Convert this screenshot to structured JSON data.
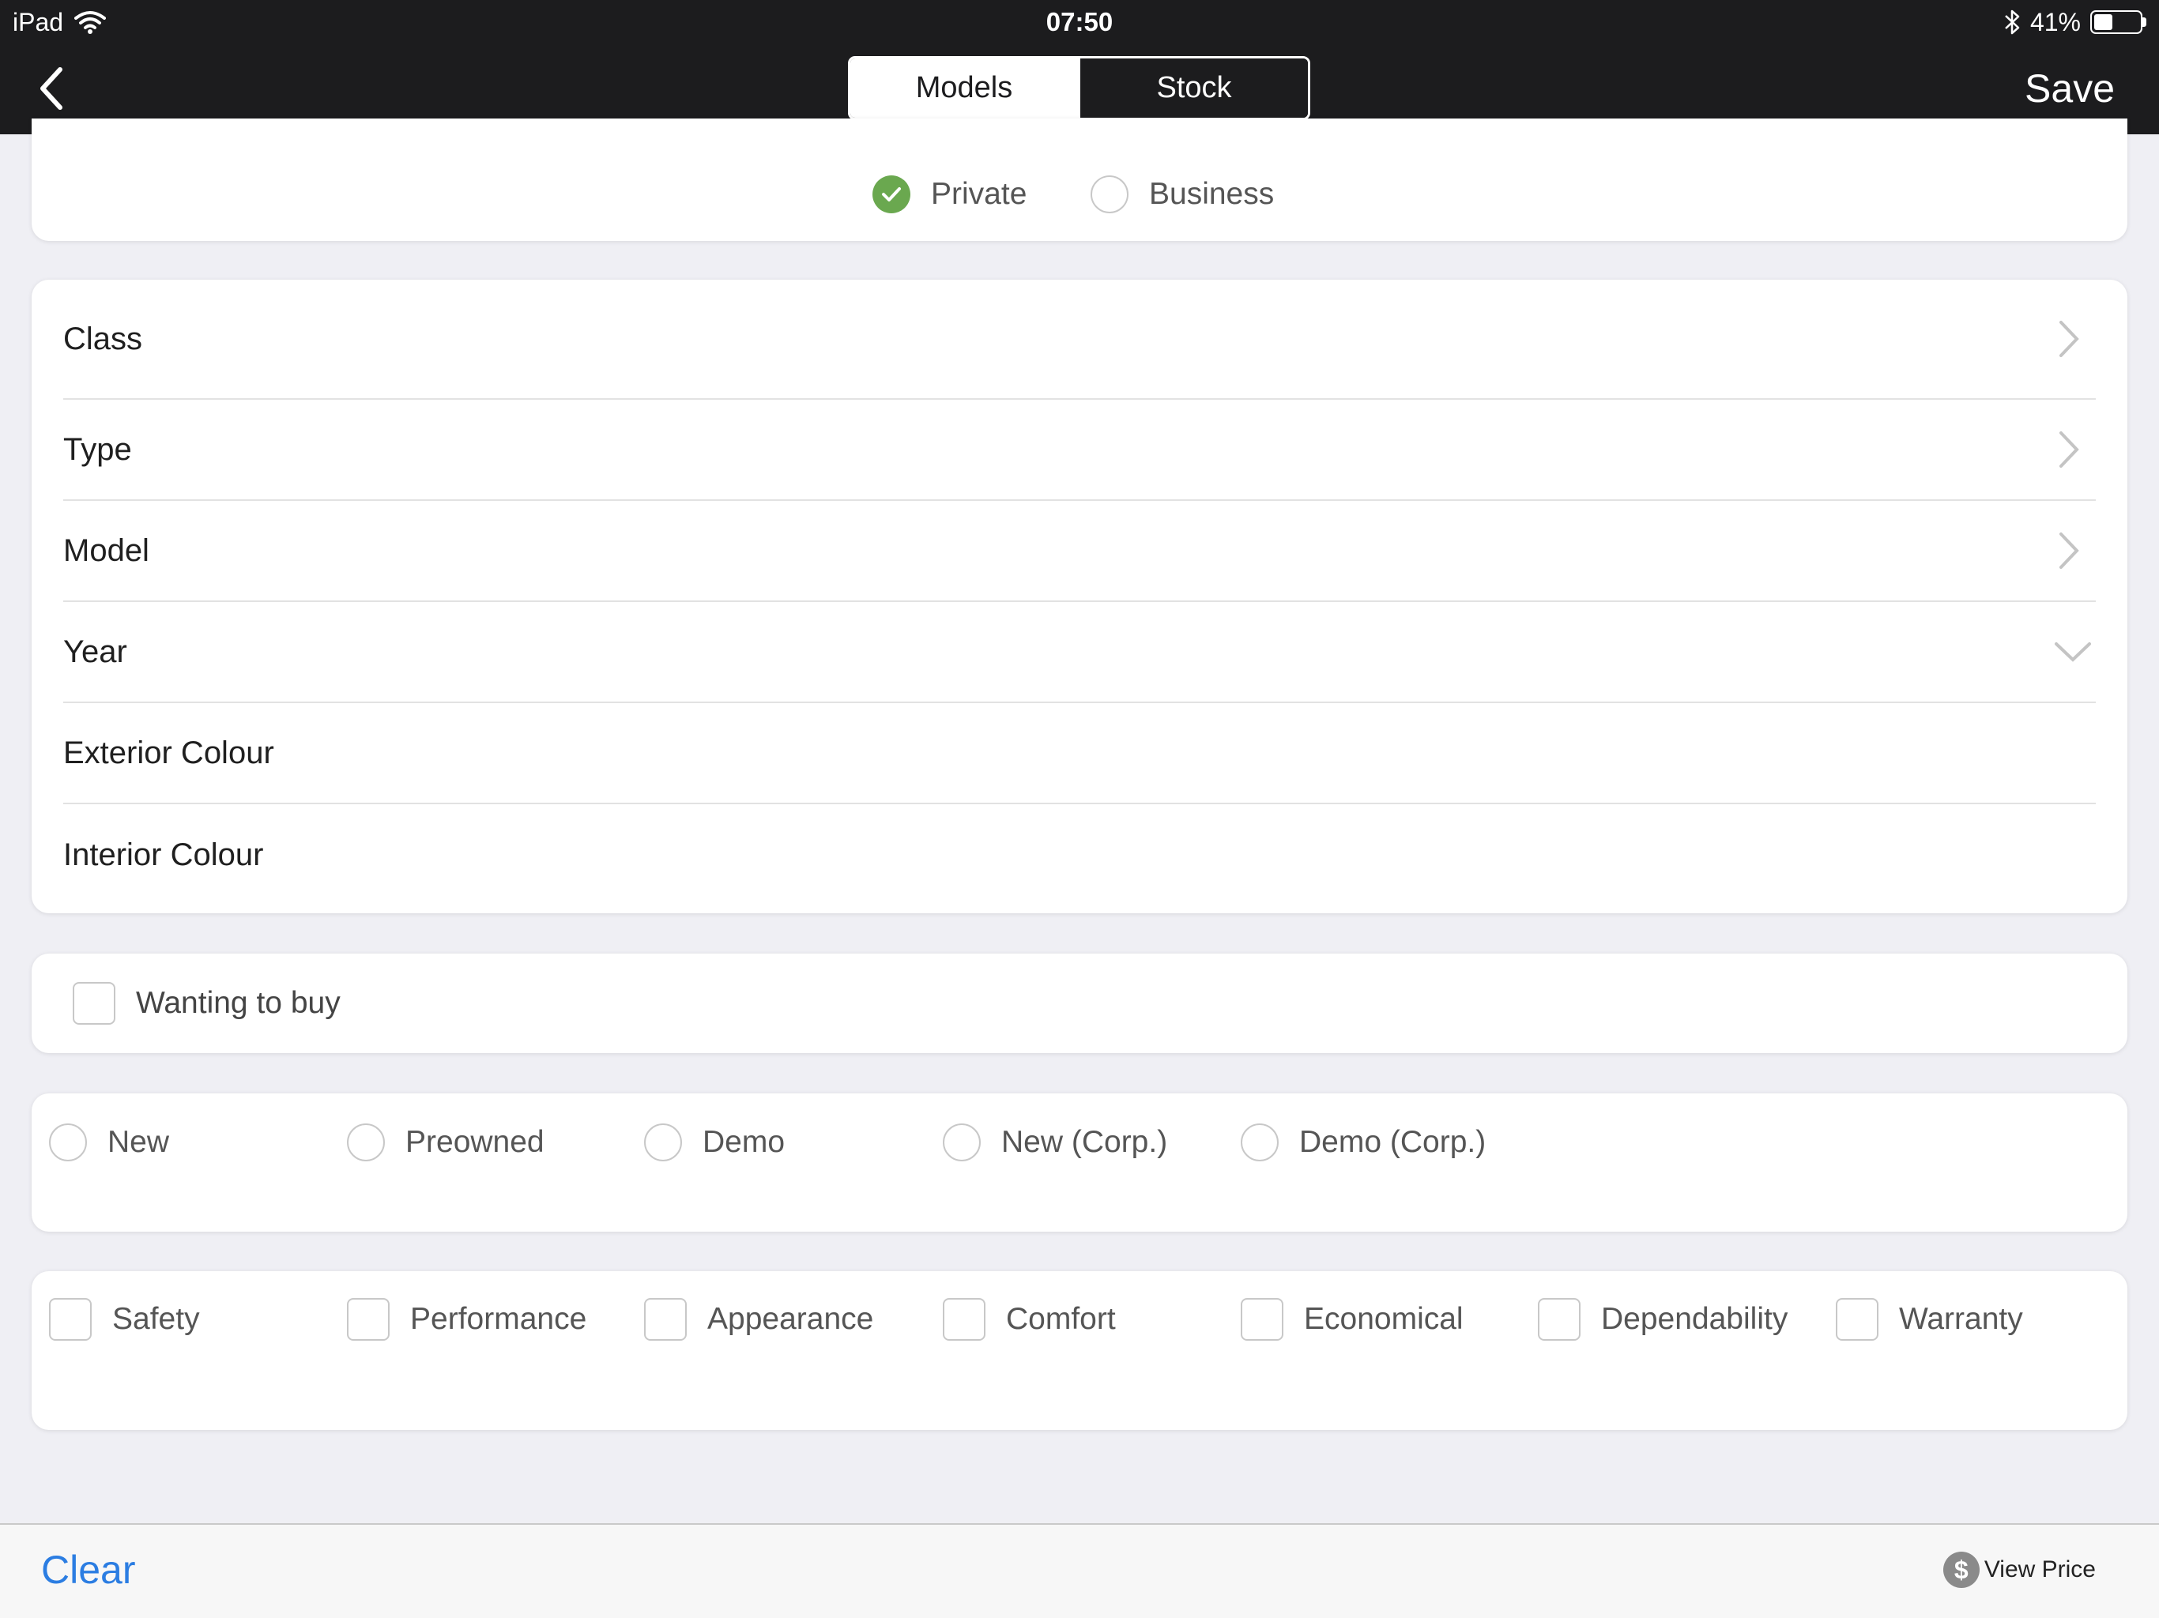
{
  "status_bar": {
    "device": "iPad",
    "time": "07:50",
    "battery": "41%",
    "battery_level": 0.41
  },
  "nav": {
    "tabs": [
      {
        "label": "Models",
        "selected": true
      },
      {
        "label": "Stock",
        "selected": false
      }
    ],
    "save_label": "Save"
  },
  "customer_type": {
    "options": [
      {
        "label": "Private",
        "selected": true
      },
      {
        "label": "Business",
        "selected": false
      }
    ]
  },
  "vehicle_fields": [
    {
      "label": "Class",
      "accessory": "chevron-right"
    },
    {
      "label": "Type",
      "accessory": "chevron-right"
    },
    {
      "label": "Model",
      "accessory": "chevron-right"
    },
    {
      "label": "Year",
      "accessory": "chevron-down"
    },
    {
      "label": "Exterior Colour",
      "accessory": "none"
    },
    {
      "label": "Interior Colour",
      "accessory": "none"
    }
  ],
  "wanting_to_buy": {
    "label": "Wanting to buy",
    "checked": false
  },
  "condition_options": [
    "New",
    "Preowned",
    "Demo",
    "New (Corp.)",
    "Demo (Corp.)"
  ],
  "feature_options": [
    "Safety",
    "Performance",
    "Appearance",
    "Comfort",
    "Economical",
    "Dependability",
    "Warranty"
  ],
  "bottom_bar": {
    "clear_label": "Clear",
    "view_price_label": "View Price",
    "dollar_symbol": "$"
  },
  "colors": {
    "nav_bg": "#1c1c1e",
    "accent_green": "#6aa84f",
    "link_blue": "#2b7de2",
    "page_bg": "#efeff4"
  }
}
